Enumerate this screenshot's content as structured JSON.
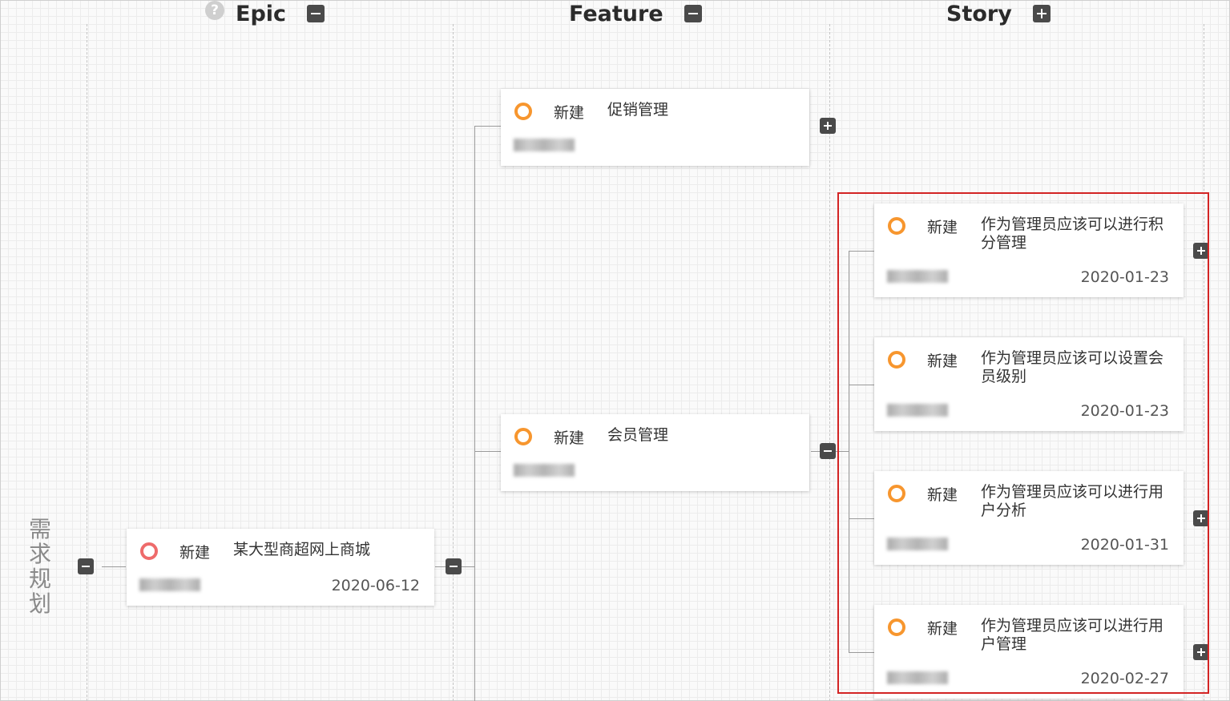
{
  "columns": {
    "epic": {
      "label": "Epic",
      "toggle_icon": "collapse-icon"
    },
    "feature": {
      "label": "Feature",
      "toggle_icon": "collapse-icon"
    },
    "story": {
      "label": "Story",
      "toggle_icon": "expand-icon"
    }
  },
  "help_icon_glyph": "?",
  "side_label": "需求规划",
  "epic_card": {
    "status": "新建",
    "title": "某大型商超网上商城",
    "date": "2020-06-12",
    "status_color": "#ee6b6b"
  },
  "feature_cards": [
    {
      "status": "新建",
      "title": "促销管理",
      "status_color": "#f7962e"
    },
    {
      "status": "新建",
      "title": "会员管理",
      "status_color": "#f7962e"
    }
  ],
  "story_cards": [
    {
      "status": "新建",
      "title": "作为管理员应该可以进行积分管理",
      "date": "2020-01-23"
    },
    {
      "status": "新建",
      "title": "作为管理员应该可以设置会员级别",
      "date": "2020-01-23"
    },
    {
      "status": "新建",
      "title": "作为管理员应该可以进行用户分析",
      "date": "2020-01-31"
    },
    {
      "status": "新建",
      "title": "作为管理员应该可以进行用户管理",
      "date": "2020-02-27"
    }
  ],
  "highlight_color": "#d32424"
}
